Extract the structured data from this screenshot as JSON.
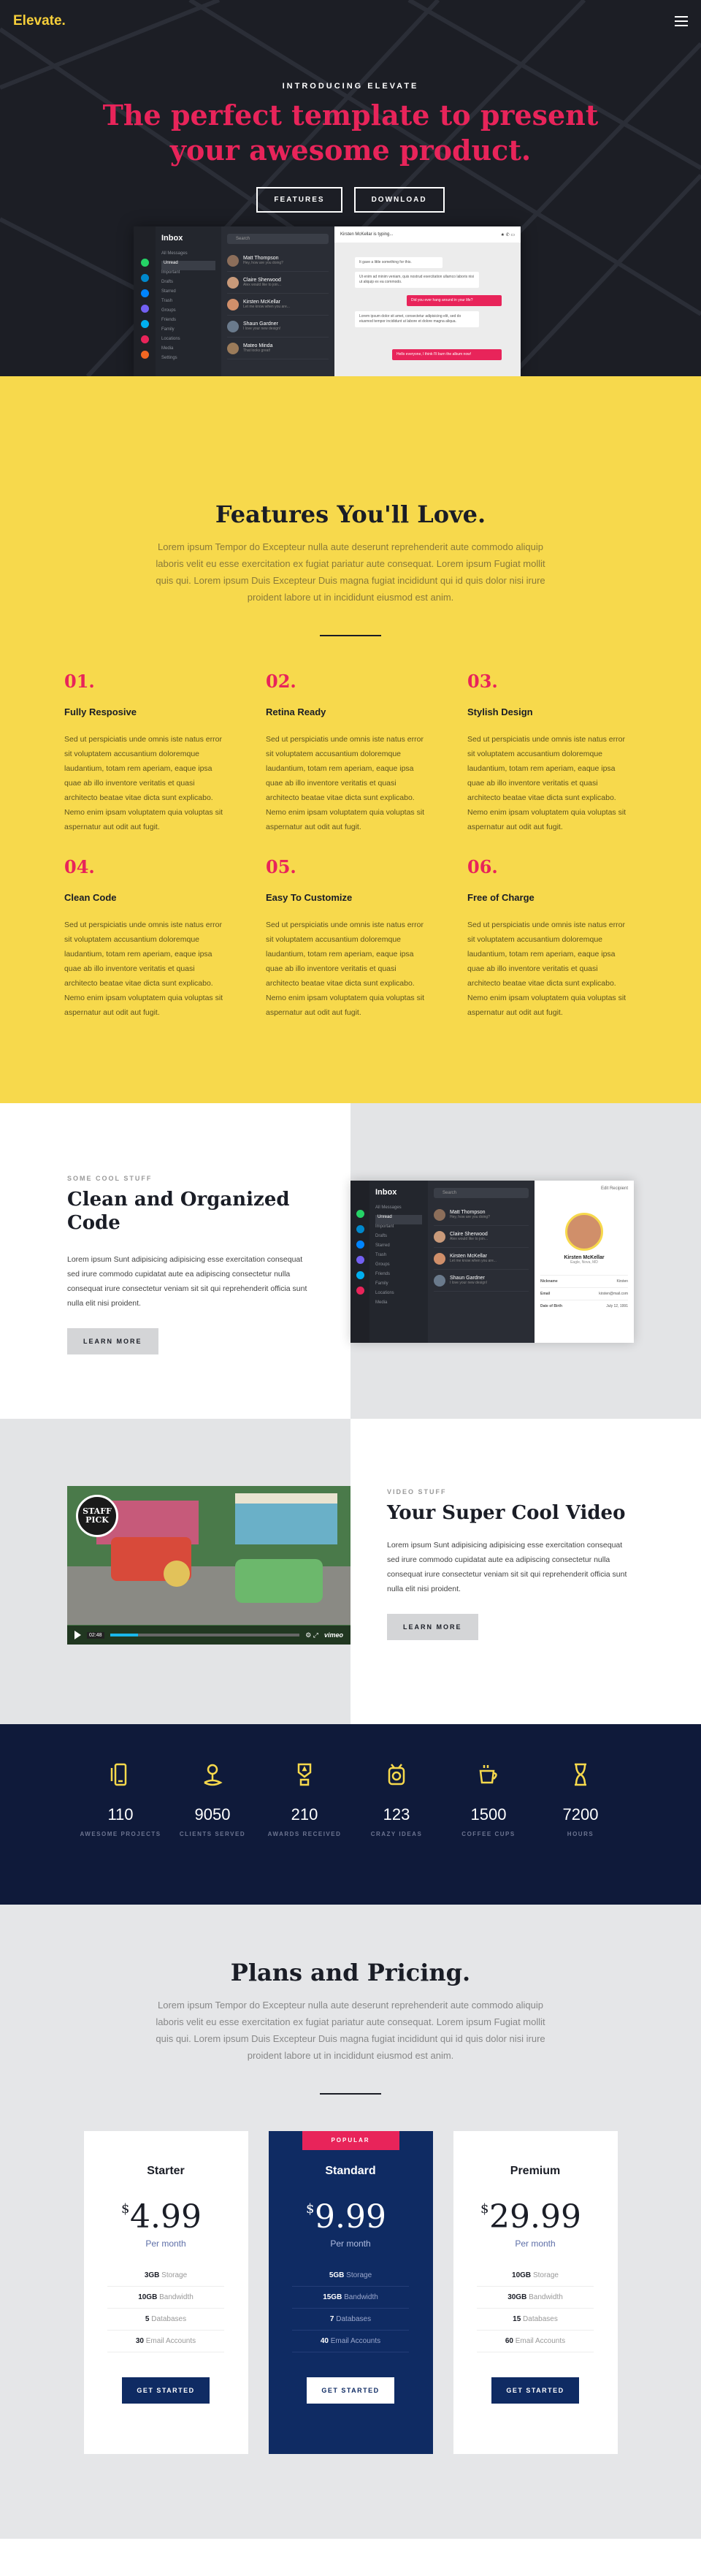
{
  "nav": {
    "brand": "Elevate.",
    "menu_icon": "hamburger-icon"
  },
  "hero": {
    "intro": "INTRODUCING ELEVATE",
    "title_line1": "The perfect template to present",
    "title_line2": "your awesome product.",
    "btn_features": "FEATURES",
    "btn_download": "DOWNLOAD",
    "mock": {
      "inbox": "Inbox",
      "search_placeholder": "Search",
      "nav_items": [
        "All Messages",
        "Unread",
        "Important",
        "Drafts",
        "Starred",
        "Trash",
        "Groups",
        "Friends",
        "Family",
        "Locations",
        "Media",
        "Settings"
      ],
      "contacts": [
        {
          "name": "Matt Thompson",
          "snippet": "Hey, how are you doing?"
        },
        {
          "name": "Claire Sherwood",
          "snippet": "Alex would like to join..."
        },
        {
          "name": "Kirsten McKellar",
          "snippet": "Let me know when you are..."
        },
        {
          "name": "Shaun Gardner",
          "snippet": "I love your new design!"
        },
        {
          "name": "Mateo Minda",
          "snippet": "That looks great!"
        }
      ],
      "chat_header": "Kirsten McKellar is typing...",
      "bubbles": [
        {
          "type": "in",
          "text": "It gave a little something for this."
        },
        {
          "type": "in",
          "text": "Ut enim ad minim veniam, quis nostrud exercitation ullamco laboris nisi ut aliquip ex ea commodo."
        },
        {
          "type": "out",
          "text": "Did you ever hang around in your life?"
        },
        {
          "type": "in",
          "text": "Lorem ipsum dolor sit amet, consectetur adipisicing elit, sed do eiusmod tempor incididunt ut labore et dolore magna aliqua."
        },
        {
          "type": "out",
          "text": "Hello everyone, I think I'll burn the album now!"
        }
      ]
    }
  },
  "features": {
    "title": "Features You'll Love.",
    "text": "Lorem ipsum Tempor do Excepteur nulla aute deserunt reprehenderit aute commodo aliquip laboris velit eu esse exercitation ex fugiat pariatur aute consequat. Lorem ipsum Fugiat mollit quis qui. Lorem ipsum Duis Excepteur Duis magna fugiat incididunt qui id quis dolor nisi irure proident labore ut in incididunt eiusmod est anim.",
    "items": [
      {
        "num": "01.",
        "title": "Fully Resposive",
        "desc": "Sed ut perspiciatis unde omnis iste natus error sit voluptatem accusantium doloremque laudantium, totam rem aperiam, eaque ipsa quae ab illo inventore veritatis et quasi architecto beatae vitae dicta sunt explicabo. Nemo enim ipsam voluptatem quia voluptas sit aspernatur aut odit aut fugit."
      },
      {
        "num": "02.",
        "title": "Retina Ready",
        "desc": "Sed ut perspiciatis unde omnis iste natus error sit voluptatem accusantium doloremque laudantium, totam rem aperiam, eaque ipsa quae ab illo inventore veritatis et quasi architecto beatae vitae dicta sunt explicabo. Nemo enim ipsam voluptatem quia voluptas sit aspernatur aut odit aut fugit."
      },
      {
        "num": "03.",
        "title": "Stylish Design",
        "desc": "Sed ut perspiciatis unde omnis iste natus error sit voluptatem accusantium doloremque laudantium, totam rem aperiam, eaque ipsa quae ab illo inventore veritatis et quasi architecto beatae vitae dicta sunt explicabo. Nemo enim ipsam voluptatem quia voluptas sit aspernatur aut odit aut fugit."
      },
      {
        "num": "04.",
        "title": "Clean Code",
        "desc": "Sed ut perspiciatis unde omnis iste natus error sit voluptatem accusantium doloremque laudantium, totam rem aperiam, eaque ipsa quae ab illo inventore veritatis et quasi architecto beatae vitae dicta sunt explicabo. Nemo enim ipsam voluptatem quia voluptas sit aspernatur aut odit aut fugit."
      },
      {
        "num": "05.",
        "title": "Easy To Customize",
        "desc": "Sed ut perspiciatis unde omnis iste natus error sit voluptatem accusantium doloremque laudantium, totam rem aperiam, eaque ipsa quae ab illo inventore veritatis et quasi architecto beatae vitae dicta sunt explicabo. Nemo enim ipsam voluptatem quia voluptas sit aspernatur aut odit aut fugit."
      },
      {
        "num": "06.",
        "title": "Free of Charge",
        "desc": "Sed ut perspiciatis unde omnis iste natus error sit voluptatem accusantium doloremque laudantium, totam rem aperiam, eaque ipsa quae ab illo inventore veritatis et quasi architecto beatae vitae dicta sunt explicabo. Nemo enim ipsam voluptatem quia voluptas sit aspernatur aut odit aut fugit."
      }
    ]
  },
  "code_section": {
    "eyebrow": "SOME COOL STUFF",
    "title_line1": "Clean and Organized",
    "title_line2": "Code",
    "text": "Lorem ipsum Sunt adipisicing adipisicing esse exercitation consequat sed irure commodo cupidatat aute ea adipiscing consectetur nulla consequat irure consectetur veniam sit sit qui reprehenderit officia sunt nulla elit nisi proident.",
    "button": "LEARN MORE",
    "profile": {
      "name": "Kirsten McKellar",
      "subtitle": "Eagle, Nova, MD",
      "header": "Edit Recipient",
      "rows": [
        [
          "Nickname",
          "Kirsten"
        ],
        [
          "Email",
          "kirsten@mail.com"
        ],
        [
          "Date of Birth",
          "July 12, 1991"
        ]
      ]
    }
  },
  "video_section": {
    "eyebrow": "VIDEO STUFF",
    "title": "Your Super Cool Video",
    "text": "Lorem ipsum Sunt adipisicing adipisicing esse exercitation consequat sed irure commodo cupidatat aute ea adipiscing consectetur nulla consequat irure consectetur veniam sit sit qui reprehenderit officia sunt nulla elit nisi proident.",
    "button": "LEARN MORE",
    "badge_line1": "STAFF",
    "badge_line2": "PICK",
    "time": "02:48",
    "player_logo": "vimeo",
    "progress": 0.15
  },
  "stats": [
    {
      "icon": "phone-icon",
      "value": "110",
      "label": "AWESOME PROJECTS"
    },
    {
      "icon": "user-location-icon",
      "value": "9050",
      "label": "CLIENTS SERVED"
    },
    {
      "icon": "award-icon",
      "value": "210",
      "label": "AWARDS RECEIVED"
    },
    {
      "icon": "idea-icon",
      "value": "123",
      "label": "CRAZY IDEAS"
    },
    {
      "icon": "coffee-icon",
      "value": "1500",
      "label": "COFFEE CUPS"
    },
    {
      "icon": "hourglass-icon",
      "value": "7200",
      "label": "HOURS"
    }
  ],
  "pricing": {
    "title": "Plans and Pricing.",
    "text": "Lorem ipsum Tempor do Excepteur nulla aute deserunt reprehenderit aute commodo aliquip laboris velit eu esse exercitation ex fugiat pariatur aute consequat. Lorem ipsum Fugiat mollit quis qui. Lorem ipsum Duis Excepteur Duis magna fugiat incididunt qui id quis dolor nisi irure proident labore ut in incididunt eiusmod est anim.",
    "popular": "POPULAR",
    "plans": [
      {
        "name": "Starter",
        "currency": "$",
        "price": "4.99",
        "period": "Per month",
        "rows": [
          [
            "3GB",
            "Storage"
          ],
          [
            "10GB",
            "Bandwidth"
          ],
          [
            "5",
            "Databases"
          ],
          [
            "30",
            "Email Accounts"
          ]
        ],
        "button": "GET STARTED"
      },
      {
        "name": "Standard",
        "currency": "$",
        "price": "9.99",
        "period": "Per month",
        "rows": [
          [
            "5GB",
            "Storage"
          ],
          [
            "15GB",
            "Bandwidth"
          ],
          [
            "7",
            "Databases"
          ],
          [
            "40",
            "Email Accounts"
          ]
        ],
        "button": "GET STARTED"
      },
      {
        "name": "Premium",
        "currency": "$",
        "price": "29.99",
        "period": "Per month",
        "rows": [
          [
            "10GB",
            "Storage"
          ],
          [
            "30GB",
            "Bandwidth"
          ],
          [
            "15",
            "Databases"
          ],
          [
            "60",
            "Email Accounts"
          ]
        ],
        "button": "GET STARTED"
      }
    ]
  },
  "colors": {
    "accent": "#e8245a",
    "yellow": "#f7d94c",
    "navy": "#0f2b63",
    "dark": "#1c1e25"
  }
}
